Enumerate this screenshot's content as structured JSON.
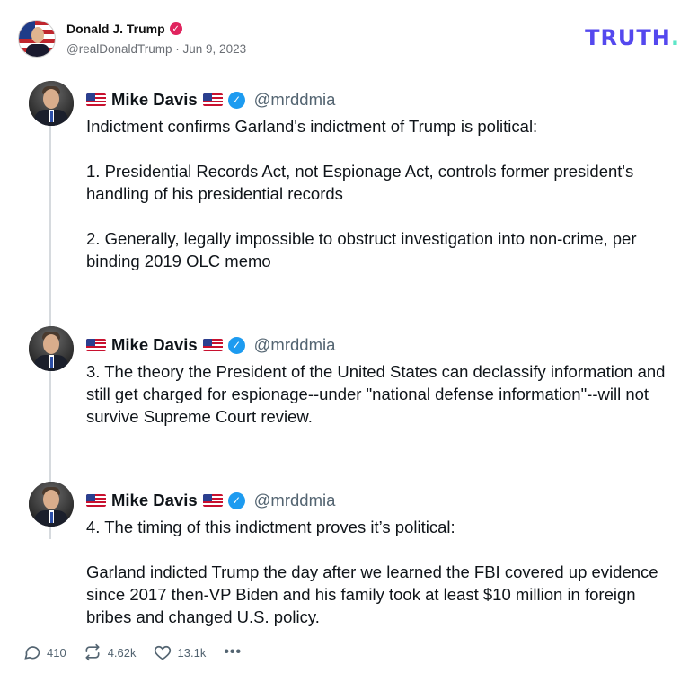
{
  "post": {
    "author_name": "Donald J. Trump",
    "author_handle": "@realDonaldTrump",
    "separator": "·",
    "date": "Jun 9, 2023",
    "brand": "TRUTH",
    "brand_dot": ".",
    "brand_color": "#5448ee"
  },
  "tweets": [
    {
      "display_name": "Mike Davis",
      "handle": "@mrddmia",
      "lines": [
        "Indictment confirms Garland's indictment of Trump is political:",
        "",
        "1. Presidential Records Act, not Espionage Act, controls former president's handling of his presidential records",
        "",
        "2. Generally, legally impossible to obstruct investigation into non-crime, per binding 2019 OLC memo"
      ]
    },
    {
      "display_name": "Mike Davis",
      "handle": "@mrddmia",
      "lines": [
        "3. The theory the President of the United States can declassify information and still get charged for espionage--under \"national defense information\"--will not survive Supreme Court review."
      ]
    },
    {
      "display_name": "Mike Davis",
      "handle": "@mrddmia",
      "lines": [
        "4. The timing of this indictment proves it’s political:",
        "",
        "Garland indicted Trump the day after we learned the FBI covered up evidence since 2017 then-VP Biden and his family took at least $10 million in foreign bribes and changed U.S. policy."
      ]
    }
  ],
  "actions": {
    "replies": "410",
    "retruths": "4.62k",
    "likes": "13.1k",
    "more": "•••"
  },
  "icons": [
    "verified-badge-icon",
    "reply-icon",
    "retruth-icon",
    "like-icon",
    "more-icon",
    "us-flag-icon",
    "verified-check-icon"
  ]
}
